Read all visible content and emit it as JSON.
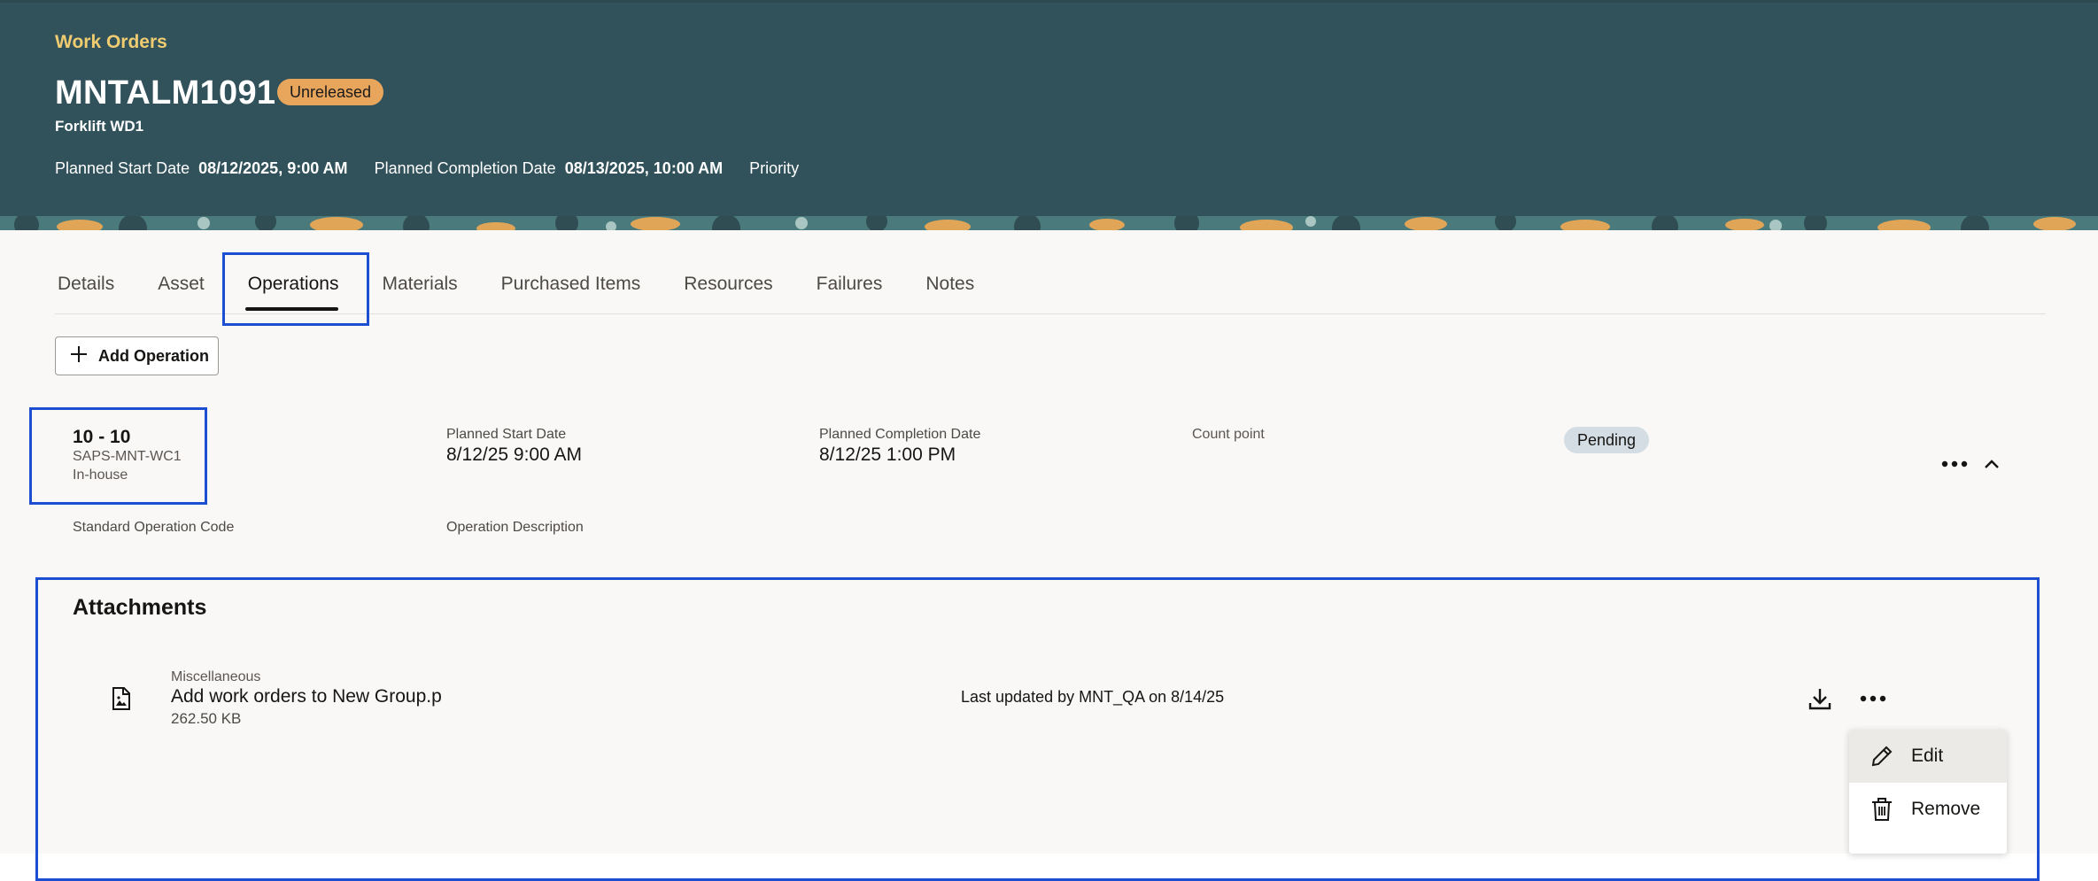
{
  "header": {
    "breadcrumb": "Work Orders",
    "work_order_number": "MNTALM1091",
    "status": "Unreleased",
    "asset_name": "Forklift WD1",
    "planned_start_label": "Planned Start Date",
    "planned_start_value": "08/12/2025, 9:00 AM",
    "planned_completion_label": "Planned Completion Date",
    "planned_completion_value": "08/13/2025, 10:00 AM",
    "priority_label": "Priority",
    "colors": {
      "background": "#31525b",
      "breadcrumb": "#f0cc71",
      "status_pill": "#e8a55c"
    }
  },
  "tabs": [
    {
      "label": "Details"
    },
    {
      "label": "Asset"
    },
    {
      "label": "Operations",
      "active": true
    },
    {
      "label": "Materials"
    },
    {
      "label": "Purchased Items"
    },
    {
      "label": "Resources"
    },
    {
      "label": "Failures"
    },
    {
      "label": "Notes"
    }
  ],
  "toolbar": {
    "add_operation_label": "Add Operation",
    "add_icon": "plus-icon"
  },
  "operation": {
    "sequence": "10 - 10",
    "work_center": "SAPS-MNT-WC1",
    "type": "In-house",
    "planned_start_label": "Planned Start Date",
    "planned_start_value": "8/12/25 9:00 AM",
    "planned_completion_label": "Planned Completion Date",
    "planned_completion_value": "8/12/25 1:00 PM",
    "count_point_label": "Count point",
    "status": "Pending",
    "standard_operation_code_label": "Standard Operation Code",
    "operation_description_label": "Operation Description",
    "actions_icon": "more-horizontal-icon",
    "collapse_icon": "chevron-up-icon"
  },
  "attachments": {
    "title": "Attachments",
    "items": [
      {
        "category": "Miscellaneous",
        "name": "Add work orders to New Group.p",
        "size": "262.50 KB",
        "last_updated": "Last updated by MNT_QA on 8/14/25",
        "file_icon": "image-file-icon",
        "download_icon": "download-icon",
        "more_icon": "more-horizontal-icon"
      }
    ],
    "menu": [
      {
        "label": "Edit",
        "icon": "pencil-icon"
      },
      {
        "label": "Remove",
        "icon": "trash-icon"
      }
    ]
  },
  "highlight_color": "#1b4ed1"
}
